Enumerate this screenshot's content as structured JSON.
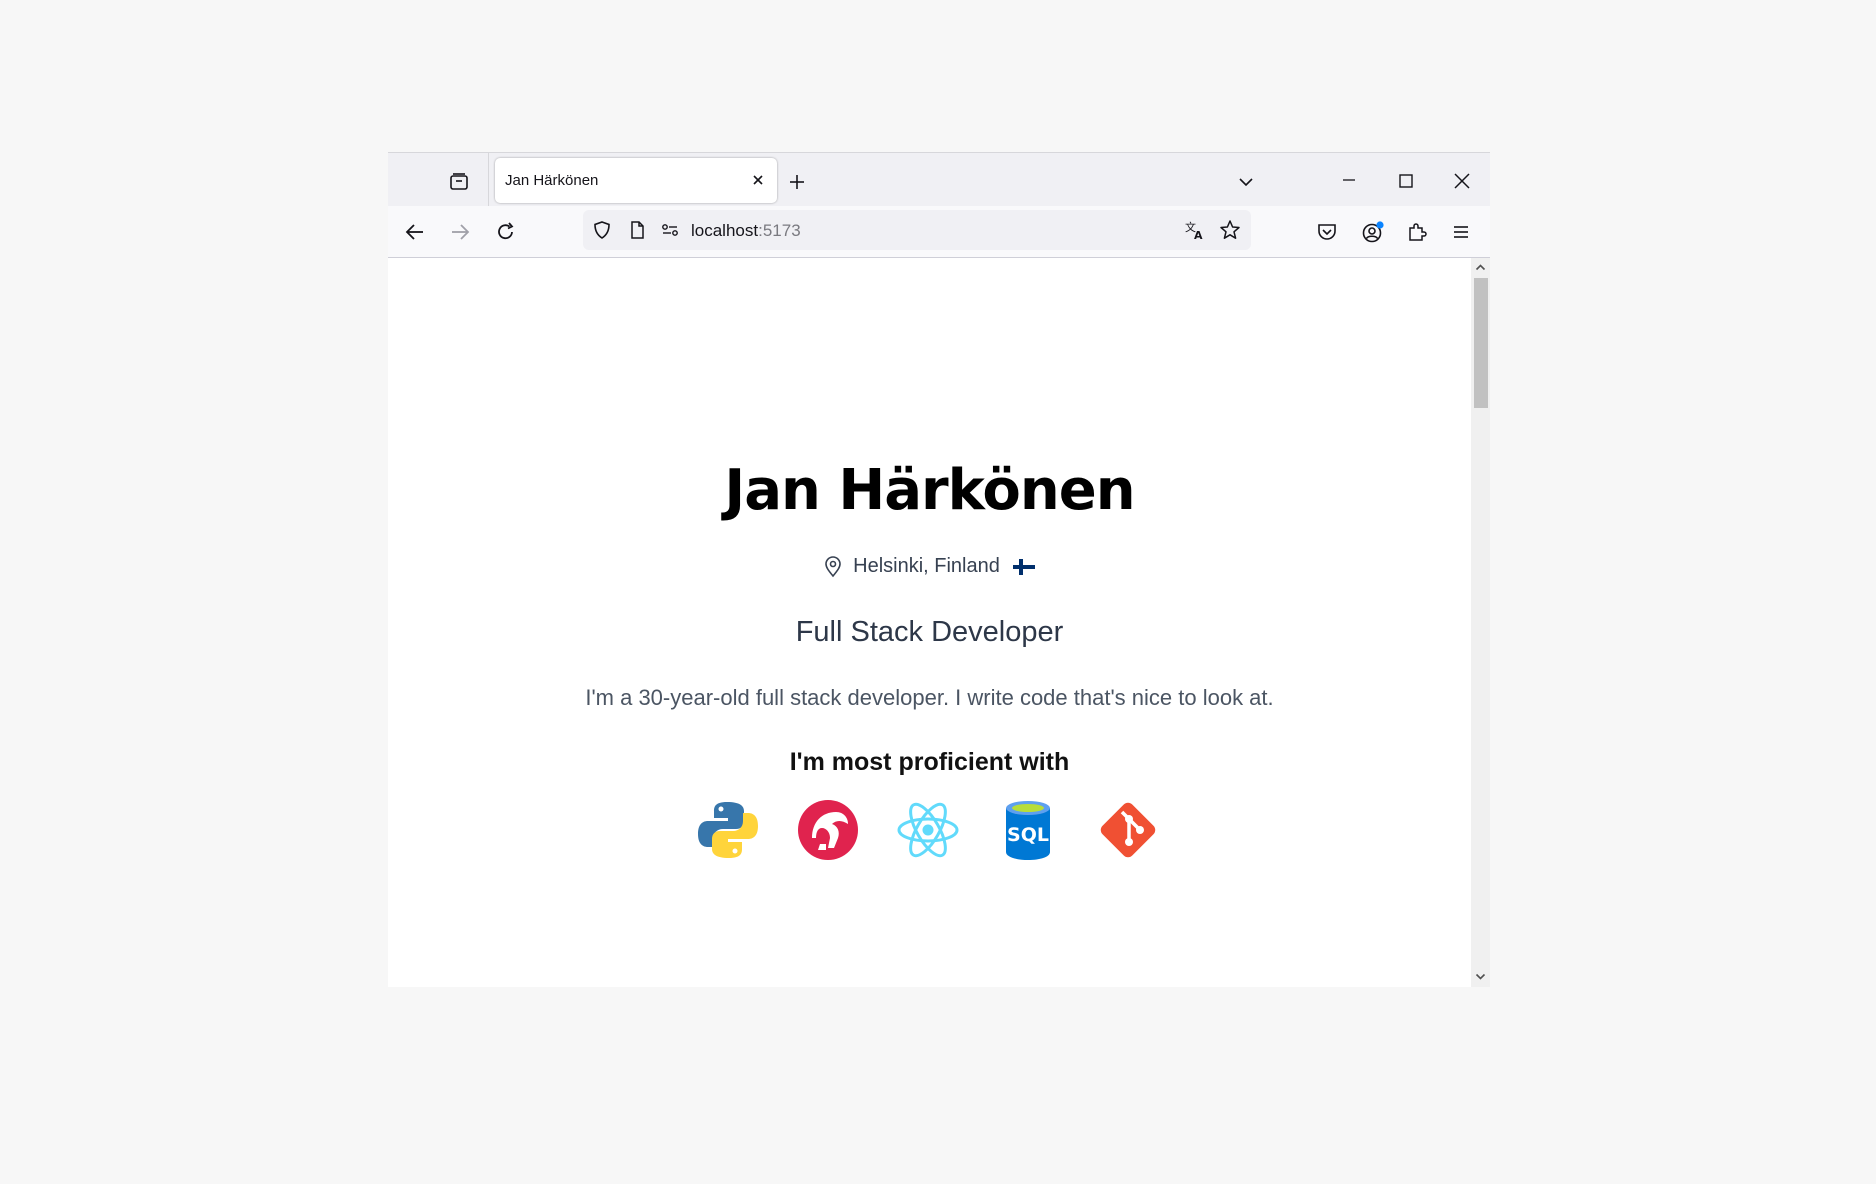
{
  "browser": {
    "tab": {
      "title": "Jan Härkönen"
    },
    "url": {
      "host": "localhost",
      "port": ":5173"
    }
  },
  "page": {
    "name": "Jan Härkönen",
    "location": "Helsinki, Finland",
    "flag": "🇫🇮",
    "role": "Full Stack Developer",
    "bio": "I'm a 30-year-old full stack developer. I write code that's nice to look at.",
    "proficient_heading": "I'm most proficient with",
    "skills": [
      {
        "icon": "python-icon"
      },
      {
        "icon": "nestjs-icon"
      },
      {
        "icon": "react-icon"
      },
      {
        "icon": "sql-database-icon"
      },
      {
        "icon": "git-icon"
      }
    ]
  },
  "colors": {
    "accent_blue": "#0060df",
    "python_blue": "#3776ab",
    "python_yellow": "#ffd43b",
    "nest_red": "#e0234e",
    "react_cyan": "#61dafb",
    "sql_blue": "#0078d4",
    "git_orange": "#f05033"
  }
}
